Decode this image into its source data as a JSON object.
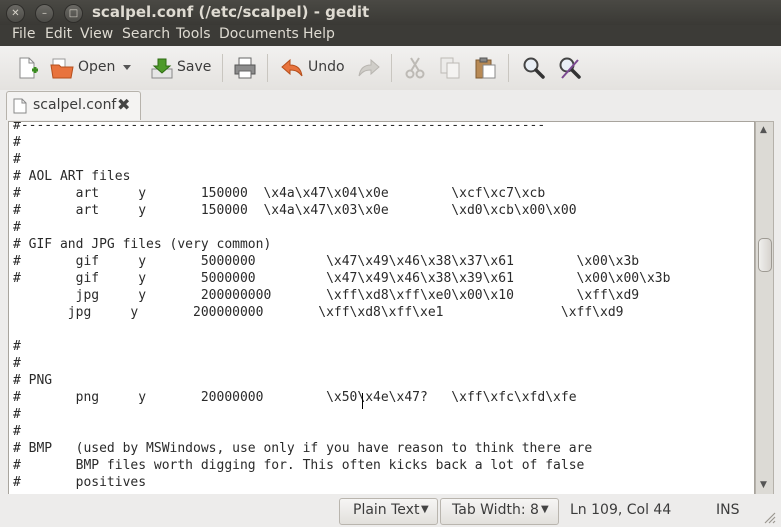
{
  "window": {
    "title": "scalpel.conf (/etc/scalpel) - gedit",
    "controls": {
      "close": "✕",
      "minimize": "–",
      "maximize": "□"
    }
  },
  "menu": [
    "File",
    "Edit",
    "View",
    "Search",
    "Tools",
    "Documents",
    "Help"
  ],
  "toolbar": {
    "open_label": "Open",
    "save_label": "Save",
    "undo_label": "Undo",
    "icons": [
      "new-document-icon",
      "open-folder-icon",
      "save-icon",
      "print-icon",
      "undo-icon",
      "redo-icon",
      "cut-icon",
      "copy-icon",
      "paste-icon",
      "search-icon",
      "replace-icon"
    ]
  },
  "tab": {
    "label": "scalpel.conf",
    "close": "✖"
  },
  "editor": {
    "lines": [
      "#-------------------------------------------------------------------",
      "#",
      "#",
      "# AOL ART files",
      "#       art     y       150000  \\x4a\\x47\\x04\\x0e        \\xcf\\xc7\\xcb",
      "#       art     y       150000  \\x4a\\x47\\x03\\x0e        \\xd0\\xcb\\x00\\x00",
      "#",
      "# GIF and JPG files (very common)",
      "#       gif     y       5000000         \\x47\\x49\\x46\\x38\\x37\\x61        \\x00\\x3b",
      "#       gif     y       5000000         \\x47\\x49\\x46\\x38\\x39\\x61        \\x00\\x00\\x3b",
      "        jpg     y       200000000       \\xff\\xd8\\xff\\xe0\\x00\\x10        \\xff\\xd9",
      "       jpg     y       200000000       \\xff\\xd8\\xff\\xe1               \\xff\\xd9",
      "",
      "#",
      "#",
      "# PNG",
      "#       png     y       20000000        \\x50\\x4e\\x47?   \\xff\\xfc\\xfd\\xfe",
      "#",
      "#",
      "# BMP   (used by MSWindows, use only if you have reason to think there are",
      "#       BMP files worth digging for. This often kicks back a lot of false",
      "#       positives"
    ]
  },
  "status": {
    "language": "Plain Text",
    "tab_width": "Tab Width:  8",
    "position": "Ln 109, Col 44",
    "mode": "INS"
  }
}
